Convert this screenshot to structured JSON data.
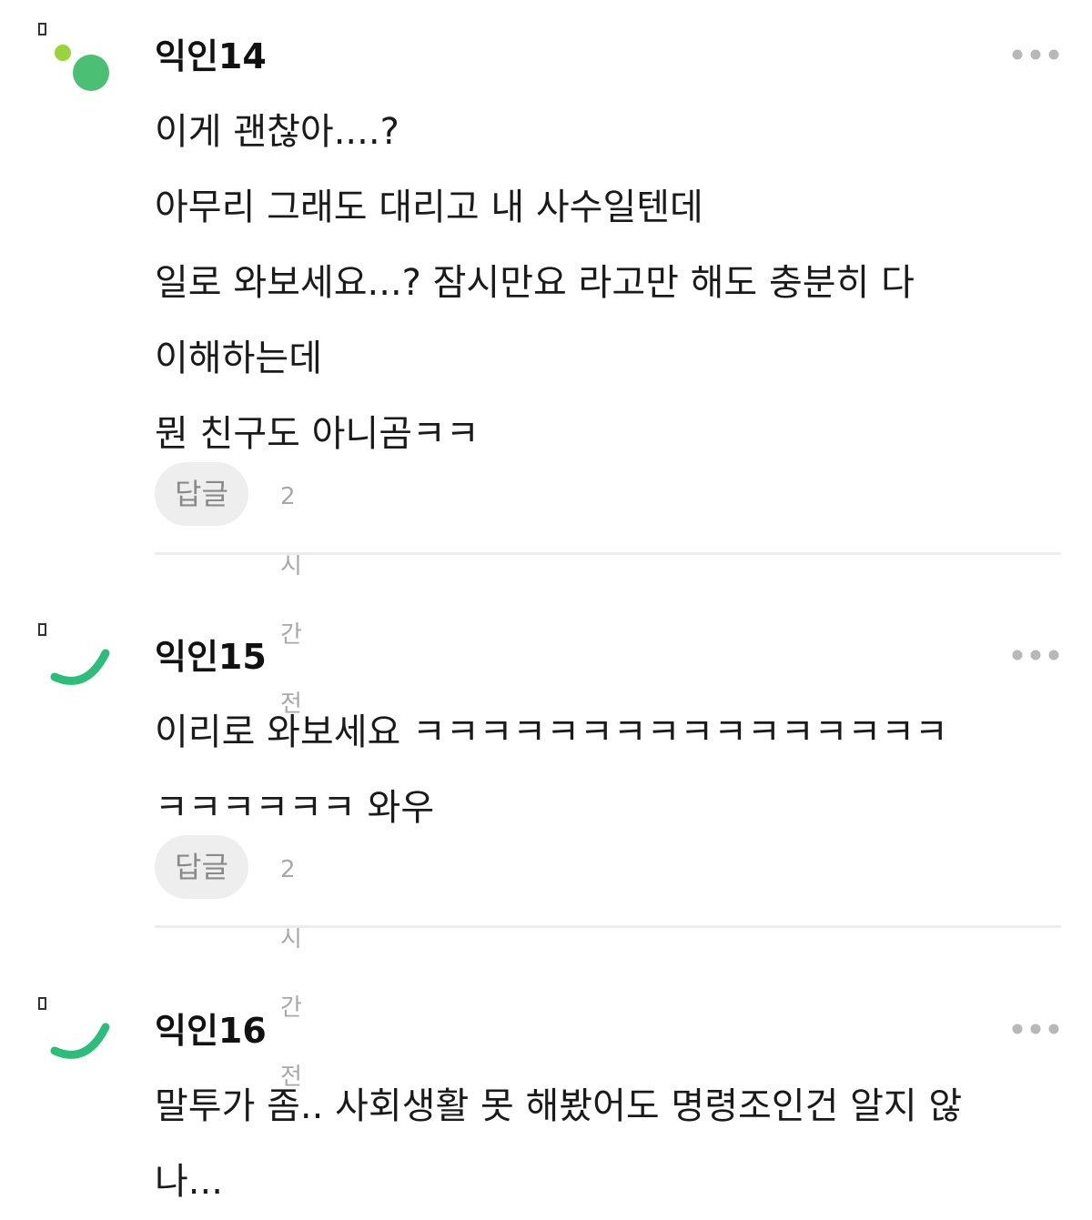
{
  "comments": [
    {
      "author": "익인14",
      "lines": [
        "이게 괜찮아....?",
        "아무리 그래도 대리고 내 사수일텐데",
        "일로 와보세요...? 잠시만요 라고만 해도 충분히 다",
        "이해하는데",
        "뭔 친구도 아니곰ㅋㅋ"
      ],
      "reply_label": "답글",
      "time": "2시간 전",
      "avatar_icon": "dots-avatar-icon"
    },
    {
      "author": "익인15",
      "lines": [
        "이리로 와보세요 ㅋㅋㅋㅋㅋㅋㅋㅋㅋㅋㅋㅋㅋㅋㅋㅋ",
        "ㅋㅋㅋㅋㅋㅋ 와우"
      ],
      "reply_label": "답글",
      "time": "2시간 전",
      "avatar_icon": "arc-avatar-icon"
    },
    {
      "author": "익인16",
      "lines": [
        "말투가 좀.. 사회생활 못 해봤어도 명령조인건 알지 않",
        "나..."
      ],
      "avatar_icon": "arc-avatar-icon"
    }
  ],
  "more_icon": "more-dots-icon",
  "colors": {
    "avatar_green": "#4bbf73",
    "avatar_lime": "#9ad33a",
    "arc_green": "#2dbd7a",
    "reply_bg": "#eeeeee",
    "divider": "#ececec"
  }
}
